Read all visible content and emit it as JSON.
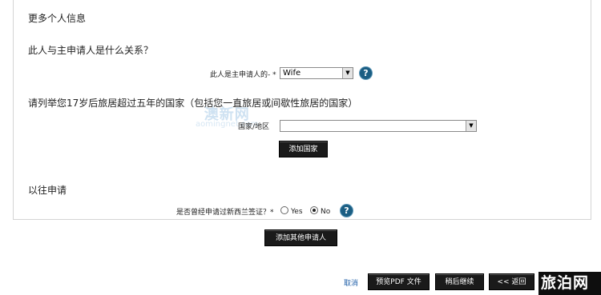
{
  "more_info": {
    "heading": "更多个人信息"
  },
  "relationship": {
    "question": "此人与主申请人是什么关系？",
    "field_label": "此人是主申请人的- *",
    "selected": "Wife"
  },
  "countries": {
    "question": "请列举您17岁后旅居超过五年的国家（包括您一直旅居或间歇性旅居的国家）",
    "field_label": "国家/地区",
    "selected": "",
    "add_button": "添加国家"
  },
  "watermark": {
    "line1": "澳新网",
    "line2": "aomingnet.com"
  },
  "previous": {
    "heading": "以往申请",
    "question": "是否曾经申请过新西兰签证？*",
    "opt_yes": "Yes",
    "opt_no": "No"
  },
  "add_applicant_button": "添加其他申请人",
  "footer": {
    "cancel": "取消",
    "preview_pdf": "预览PDF 文件",
    "save_later": "稍后继续",
    "back": "<< 返回",
    "logo_text": "旅泊网"
  },
  "colors": {
    "help_icon": "#1b5e83",
    "button_bg": "#1a1a1a",
    "link": "#1f5fa8"
  },
  "icons": {
    "help": "question-mark-circle-icon",
    "dropdown": "chevron-down-icon"
  }
}
